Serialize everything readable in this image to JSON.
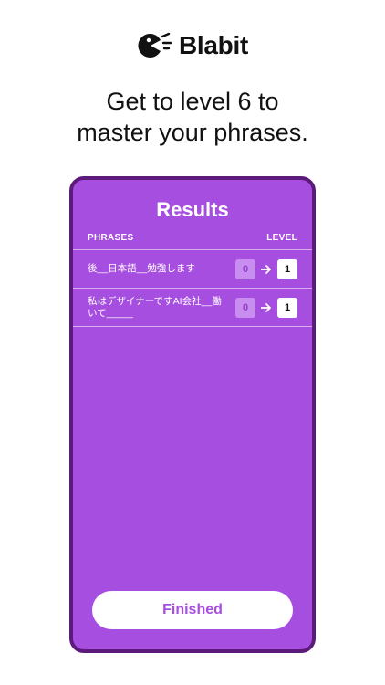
{
  "brand": {
    "name": "Blabit",
    "icon": "blabit-logo-icon"
  },
  "headline": {
    "line1": "Get to level 6 to",
    "line2": "master your phrases."
  },
  "results": {
    "title": "Results",
    "col_phrases": "PHRASES",
    "col_level": "LEVEL",
    "rows": [
      {
        "phrase": "後__日本語__勉強します",
        "from": "0",
        "to": "1"
      },
      {
        "phrase": "私はデザイナーですAI会社__働いて_____",
        "from": "0",
        "to": "1"
      }
    ],
    "finish_label": "Finished"
  },
  "colors": {
    "accent": "#a64ee0",
    "frame": "#5c1a7a",
    "level_from_bg": "#c98cf0"
  }
}
